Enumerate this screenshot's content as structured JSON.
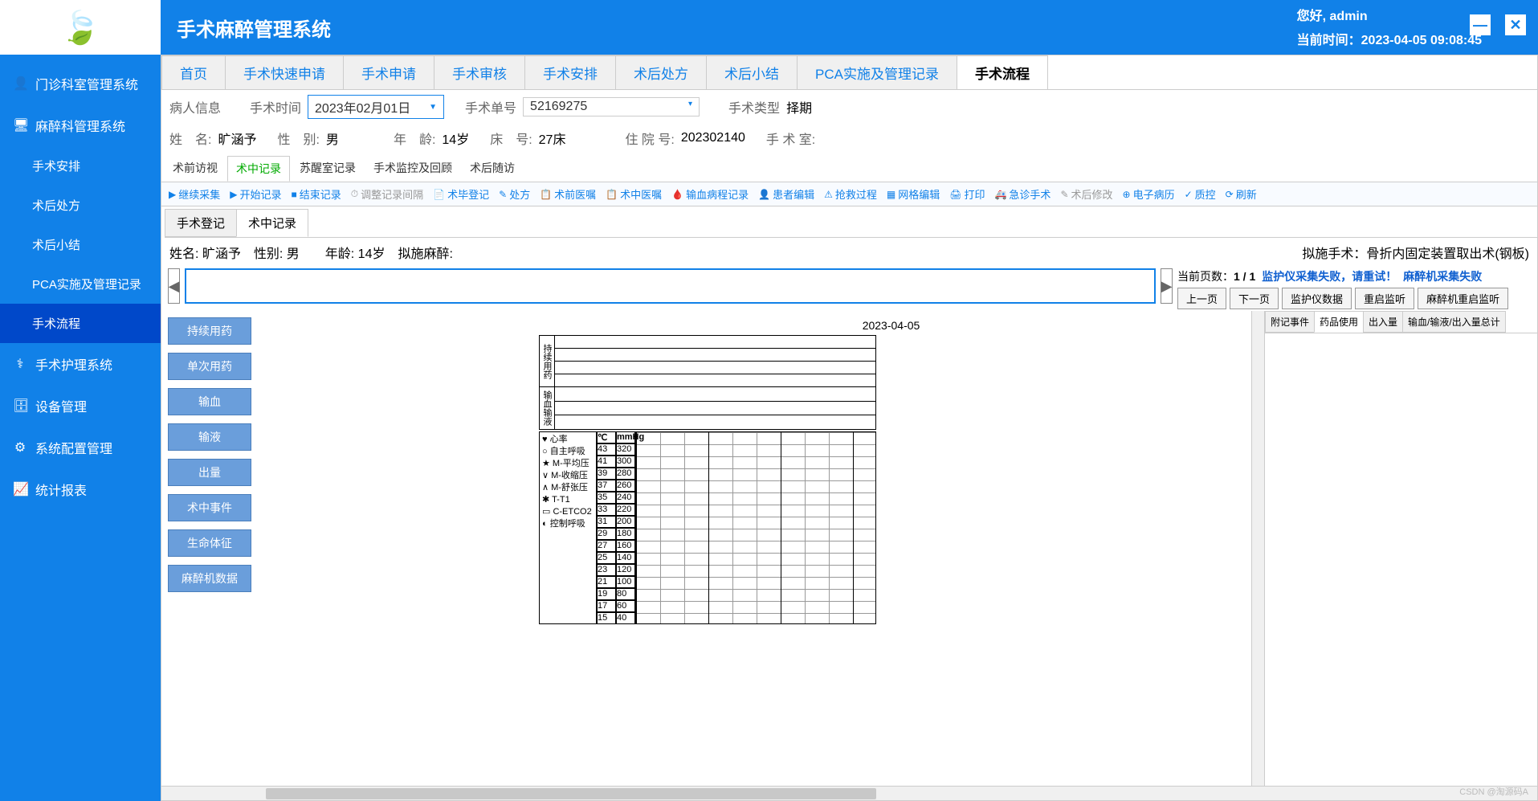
{
  "header": {
    "app_title": "手术麻醉管理系统",
    "greeting": "您好, admin",
    "time_label": "当前时间：",
    "time_value": "2023-04-05 09:08:45"
  },
  "sidebar": {
    "items": [
      {
        "icon": "👤",
        "label": "门诊科室管理系统"
      },
      {
        "icon": "🖥",
        "label": "麻醉科管理系统"
      }
    ],
    "subs": [
      {
        "label": "手术安排"
      },
      {
        "label": "术后处方"
      },
      {
        "label": "术后小结"
      },
      {
        "label": "PCA实施及管理记录"
      },
      {
        "label": "手术流程",
        "active": true
      }
    ],
    "items2": [
      {
        "icon": "⚕",
        "label": "手术护理系统"
      },
      {
        "icon": "🗄",
        "label": "设备管理"
      },
      {
        "icon": "⚙",
        "label": "系统配置管理"
      },
      {
        "icon": "📈",
        "label": "统计报表"
      }
    ]
  },
  "top_tabs": [
    "首页",
    "手术快速申请",
    "手术申请",
    "手术审核",
    "手术安排",
    "术后处方",
    "术后小结",
    "PCA实施及管理记录",
    "手术流程"
  ],
  "top_tab_active": 8,
  "info": {
    "patient_info": "病人信息",
    "surgery_time_lbl": "手术时间",
    "surgery_time_val": "2023年02月01日",
    "order_no_lbl": "手术单号",
    "order_no_val": "52169275",
    "type_lbl": "手术类型",
    "type_val": "择期",
    "name_lbl": "姓　名:",
    "name_val": "旷涵予",
    "sex_lbl": "性　别:",
    "sex_val": "男",
    "age_lbl": "年　龄:",
    "age_val": "14岁",
    "bed_lbl": "床　号:",
    "bed_val": "27床",
    "inpatient_lbl": "住 院 号:",
    "inpatient_val": "202302140",
    "room_lbl": "手 术 室:",
    "room_val": ""
  },
  "sub_tabs": [
    "术前访视",
    "术中记录",
    "苏醒室记录",
    "手术监控及回顾",
    "术后随访"
  ],
  "sub_tab_active": 1,
  "toolbar": [
    {
      "icon": "▶",
      "label": "继续采集"
    },
    {
      "icon": "▶",
      "label": "开始记录"
    },
    {
      "icon": "■",
      "label": "结束记录"
    },
    {
      "icon": "⏱",
      "label": "调整记录间隔",
      "disabled": true
    },
    {
      "icon": "📄",
      "label": "术毕登记"
    },
    {
      "icon": "✎",
      "label": "处方"
    },
    {
      "icon": "📋",
      "label": "术前医嘱"
    },
    {
      "icon": "📋",
      "label": "术中医嘱"
    },
    {
      "icon": "🩸",
      "label": "输血病程记录"
    },
    {
      "icon": "👤",
      "label": "患者编辑"
    },
    {
      "icon": "⚠",
      "label": "抢救过程"
    },
    {
      "icon": "▦",
      "label": "网格编辑"
    },
    {
      "icon": "🖨",
      "label": "打印"
    },
    {
      "icon": "🚑",
      "label": "急诊手术"
    },
    {
      "icon": "✎",
      "label": "术后修改",
      "disabled": true
    },
    {
      "icon": "⊕",
      "label": "电子病历"
    },
    {
      "icon": "✓",
      "label": "质控"
    },
    {
      "icon": "⟳",
      "label": "刷新"
    }
  ],
  "content_tabs": [
    "手术登记",
    "术中记录"
  ],
  "content_tab_active": 1,
  "patient_line": {
    "left": "姓名: 旷涵予　性别: 男　　年龄: 14岁　拟施麻醉:",
    "right_lbl": "拟施手术：",
    "right_val": "骨折内固定装置取出术(钢板)"
  },
  "pager": {
    "cur_label": "当前页数：",
    "cur_val": "1 / 1",
    "warn1": "监护仪采集失败，请重试！",
    "warn2": "麻醉机采集失败",
    "btns": [
      "上一页",
      "下一页",
      "监护仪数据",
      "重启监听",
      "麻醉机重启监听"
    ]
  },
  "med_btns": [
    "持续用药",
    "单次用药",
    "输血",
    "输液",
    "出量",
    "术中事件",
    "生命体征",
    "麻醉机数据"
  ],
  "chart": {
    "date": "2023-04-05",
    "row_groups": [
      "持续用药",
      "输血输液"
    ],
    "legend": [
      "♥ 心率",
      "○ 自主呼吸",
      "★ M-平均压",
      "∨ M-收缩压",
      "∧ M-舒张压",
      "✱ T-T1",
      "▭ C-ETCO2",
      "◐ 控制呼吸"
    ],
    "scale_c_header": "℃",
    "scale_p_header": "mmHg",
    "scale_c": [
      "43",
      "41",
      "39",
      "37",
      "35",
      "33",
      "31",
      "29",
      "27",
      "25",
      "23",
      "21",
      "19",
      "17",
      "15"
    ],
    "scale_p": [
      "320",
      "300",
      "280",
      "260",
      "240",
      "220",
      "200",
      "180",
      "160",
      "140",
      "120",
      "100",
      "80",
      "60",
      "40"
    ]
  },
  "right_tabs": [
    "附记事件",
    "药品使用",
    "出入量",
    "输血/输液/出入量总计"
  ],
  "right_tab_active": 1,
  "watermark": "CSDN @淘源码A"
}
